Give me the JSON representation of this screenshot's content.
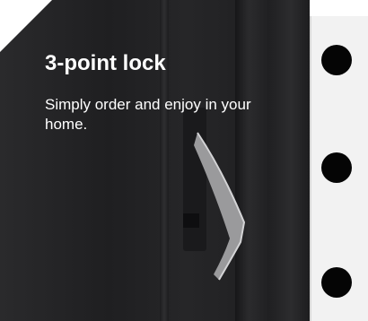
{
  "headline": "3-point lock",
  "description": "Simply order and enjoy in your home.",
  "colors": {
    "door": "#242426",
    "plate": "#f2f2f2",
    "text": "#ffffff"
  },
  "icons": [
    "door-handle-icon",
    "lock-hole-icon"
  ]
}
